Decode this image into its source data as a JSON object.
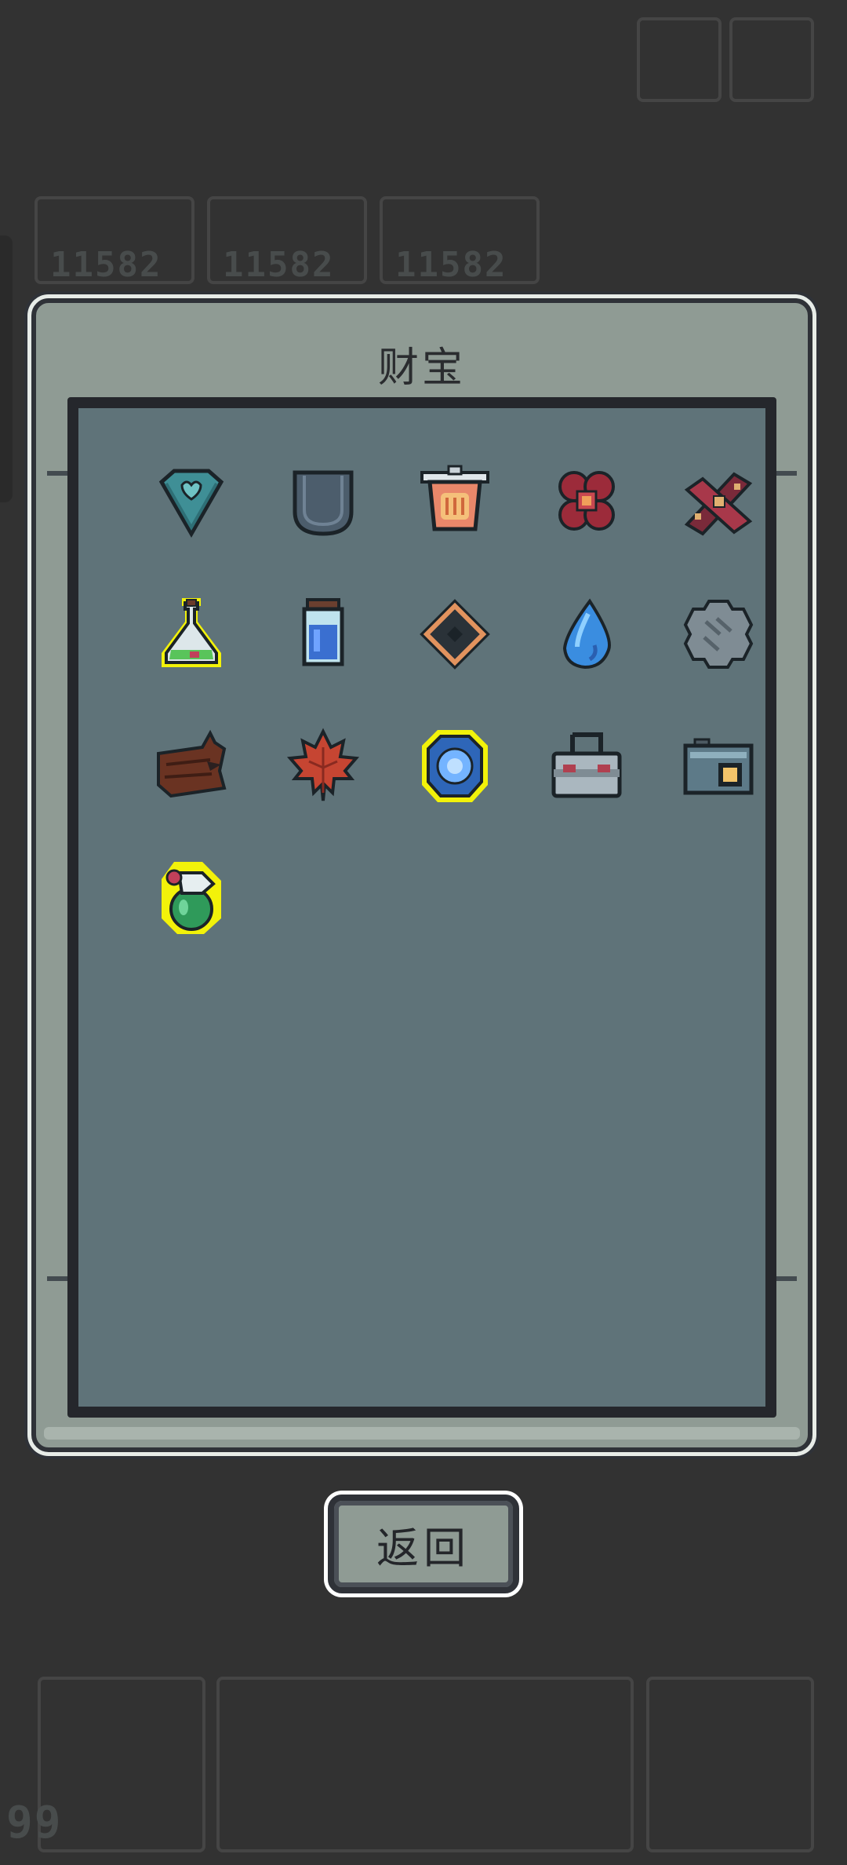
{
  "dialog": {
    "title": "财宝"
  },
  "back_button": {
    "label": "返回"
  },
  "background": {
    "resource_counts": [
      "11582",
      "11582",
      "11582"
    ],
    "corner_count": "99"
  },
  "items": [
    {
      "name": "teal-heart-gem-icon",
      "highlighted": false
    },
    {
      "name": "grey-pocket-icon",
      "highlighted": false
    },
    {
      "name": "lantern-cup-icon",
      "highlighted": false
    },
    {
      "name": "red-flower-icon",
      "highlighted": false
    },
    {
      "name": "dna-ribbon-icon",
      "highlighted": false
    },
    {
      "name": "green-potion-flask-icon",
      "highlighted": true
    },
    {
      "name": "blue-jar-icon",
      "highlighted": false
    },
    {
      "name": "diamond-rune-icon",
      "highlighted": false
    },
    {
      "name": "water-drop-icon",
      "highlighted": false
    },
    {
      "name": "stone-gear-icon",
      "highlighted": false
    },
    {
      "name": "wooden-log-icon",
      "highlighted": false
    },
    {
      "name": "maple-leaf-icon",
      "highlighted": false
    },
    {
      "name": "blue-orb-badge-icon",
      "highlighted": true
    },
    {
      "name": "metal-lunchbox-icon",
      "highlighted": false
    },
    {
      "name": "camera-icon",
      "highlighted": false
    },
    {
      "name": "green-bottle-gourd-icon",
      "highlighted": true
    }
  ],
  "colors": {
    "highlight": "#f2f20a",
    "panel": "#5f7379",
    "frame": "#8f9b94"
  }
}
